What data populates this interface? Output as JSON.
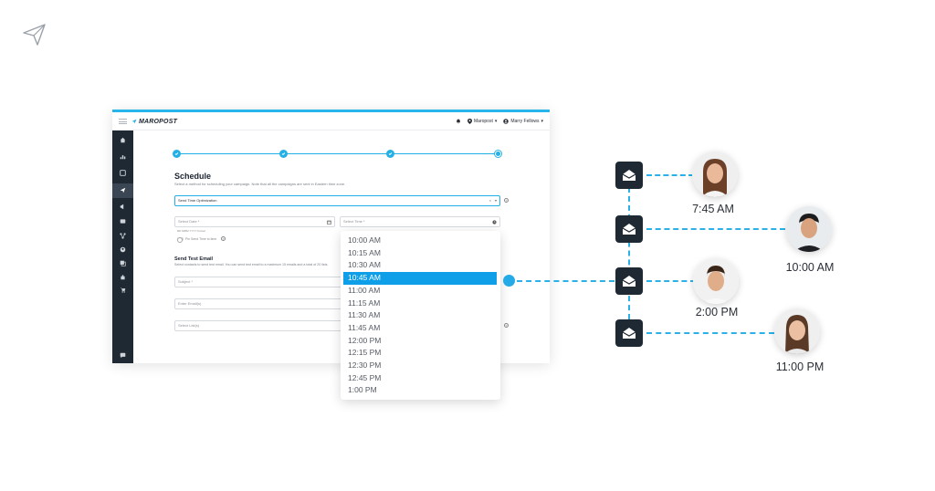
{
  "app": {
    "brand": "MAROPOST",
    "topbar": {
      "account": "Maropost",
      "user": "Marry Fellows"
    }
  },
  "schedule": {
    "title": "Schedule",
    "description": "Select a method for scheduling your campaign. Note that all the campaigns are sent in Eastern time zone.",
    "method_value": "Send Time Optimization",
    "date_placeholder": "Select Date *",
    "date_format_hint": "DD MMM YYYY format",
    "time_placeholder": "Select Time *",
    "toggle_label": "Pin Send Time to time"
  },
  "send_test": {
    "title": "Send Test Email",
    "description": "Select contacts to send test email. You can send test email to a maximum 15 emails and a total of 20 lists.",
    "subject_placeholder": "Subject *",
    "email_placeholder": "Enter Email(s)",
    "list_placeholder": "Select List(s)"
  },
  "time_options": [
    "10:00 AM",
    "10:15 AM",
    "10:30 AM",
    "10:45 AM",
    "11:00 AM",
    "11:15 AM",
    "11:30 AM",
    "11:45 AM",
    "12:00 PM",
    "12:15 PM",
    "12:30 PM",
    "12:45 PM",
    "1:00 PM"
  ],
  "time_selected": "10:45 AM",
  "recipients": [
    {
      "time": "7:45 AM"
    },
    {
      "time": "10:00 AM"
    },
    {
      "time": "2:00 PM"
    },
    {
      "time": "11:00 PM"
    }
  ],
  "colors": {
    "accent": "#23b0e6",
    "sidebar": "#1f2933",
    "selected": "#0f9ee8"
  }
}
